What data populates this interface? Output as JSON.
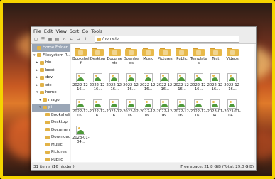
{
  "menu": [
    "File",
    "Edit",
    "View",
    "Sort",
    "Go",
    "Tools"
  ],
  "path": "/home/pi",
  "sidebar": {
    "items": [
      {
        "label": "Home Folder",
        "selected": true,
        "indent": 0,
        "exp": ""
      },
      {
        "label": "Filesystem R...",
        "selected": false,
        "indent": 0,
        "exp": "▾"
      },
      {
        "label": "bin",
        "selected": false,
        "indent": 1,
        "exp": "▸"
      },
      {
        "label": "boot",
        "selected": false,
        "indent": 1,
        "exp": "▸"
      },
      {
        "label": "dev",
        "selected": false,
        "indent": 1,
        "exp": "▸"
      },
      {
        "label": "etc",
        "selected": false,
        "indent": 1,
        "exp": "▸"
      },
      {
        "label": "home",
        "selected": false,
        "indent": 1,
        "exp": "▾"
      },
      {
        "label": "mago",
        "selected": false,
        "indent": 2,
        "exp": "▾"
      },
      {
        "label": "pi",
        "selected": true,
        "indent": 2,
        "exp": "▾"
      },
      {
        "label": "Bookshelf",
        "selected": false,
        "indent": 3,
        "exp": ""
      },
      {
        "label": "Desktop",
        "selected": false,
        "indent": 3,
        "exp": ""
      },
      {
        "label": "Documents",
        "selected": false,
        "indent": 3,
        "exp": ""
      },
      {
        "label": "Downloads",
        "selected": false,
        "indent": 3,
        "exp": ""
      },
      {
        "label": "Music",
        "selected": false,
        "indent": 3,
        "exp": ""
      },
      {
        "label": "Pictures",
        "selected": false,
        "indent": 3,
        "exp": ""
      },
      {
        "label": "Public",
        "selected": false,
        "indent": 3,
        "exp": ""
      }
    ]
  },
  "folders": [
    "Bookshelf",
    "Desktop",
    "Documents",
    "Downloads",
    "Music",
    "Pictures",
    "Public",
    "Templates",
    "Test",
    "Videos"
  ],
  "images": [
    "2022-12-16...",
    "2022-12-16...",
    "2022-12-16...",
    "2022-12-16...",
    "2022-12-16...",
    "2022-12-16...",
    "2022-12-16...",
    "2022-12-16...",
    "2022-12-16...",
    "2022-12-16...",
    "2022-12-16...",
    "2022-12-16...",
    "2022-12-16...",
    "2022-12-16...",
    "2022-12-16...",
    "2022-12-16...",
    "2022-12-16...",
    "2022-12-16...",
    "2023-01-04...",
    "2023-01-04...",
    "2023-01-04..."
  ],
  "status": {
    "left": "31 items (16 hidden)",
    "right": "Free space: 21.8 GiB (Total: 29.0 GiB)"
  },
  "colors": {
    "frame_border": "#f5d400",
    "folder": "#e8b94a",
    "selection": "#9aa6b6"
  }
}
